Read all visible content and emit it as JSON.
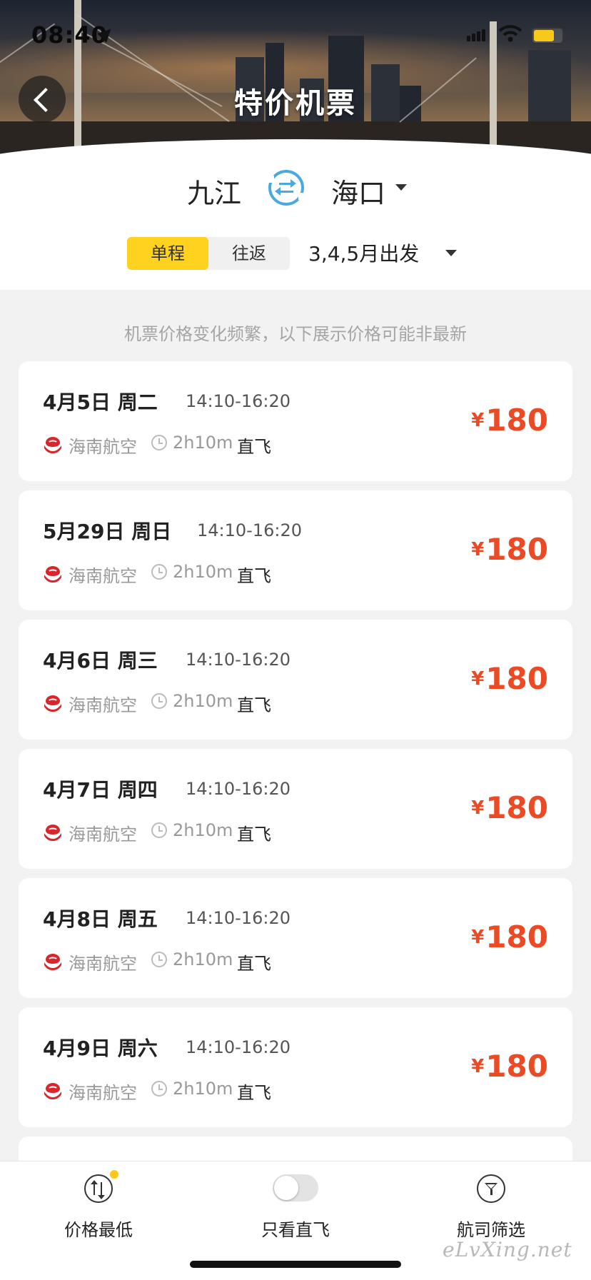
{
  "status_bar": {
    "time": "08:40"
  },
  "header": {
    "title": "特价机票"
  },
  "route": {
    "from_city": "九江",
    "to_city": "海口",
    "trip_types": [
      {
        "label": "单程",
        "selected": true
      },
      {
        "label": "往返",
        "selected": false
      }
    ],
    "departure": "3,4,5月出发"
  },
  "notice": "机票价格变化频繁，以下展示价格可能非最新",
  "flights": [
    {
      "date": "4月5日 周二",
      "time": "14:10-16:20",
      "airline": "海南航空",
      "duration": "2h10m",
      "type": "直飞",
      "currency": "¥",
      "price": "180"
    },
    {
      "date": "5月29日 周日",
      "time": "14:10-16:20",
      "airline": "海南航空",
      "duration": "2h10m",
      "type": "直飞",
      "currency": "¥",
      "price": "180"
    },
    {
      "date": "4月6日 周三",
      "time": "14:10-16:20",
      "airline": "海南航空",
      "duration": "2h10m",
      "type": "直飞",
      "currency": "¥",
      "price": "180"
    },
    {
      "date": "4月7日 周四",
      "time": "14:10-16:20",
      "airline": "海南航空",
      "duration": "2h10m",
      "type": "直飞",
      "currency": "¥",
      "price": "180"
    },
    {
      "date": "4月8日 周五",
      "time": "14:10-16:20",
      "airline": "海南航空",
      "duration": "2h10m",
      "type": "直飞",
      "currency": "¥",
      "price": "180"
    },
    {
      "date": "4月9日 周六",
      "time": "14:10-16:20",
      "airline": "海南航空",
      "duration": "2h10m",
      "type": "直飞",
      "currency": "¥",
      "price": "180"
    }
  ],
  "tabbar": {
    "price_sort": "价格最低",
    "direct_only": "只看直飞",
    "direct_only_enabled": false,
    "airline_filter": "航司筛选"
  },
  "watermark": "eLvXing.net",
  "colors": {
    "accent_yellow": "#ffd21f",
    "price_red": "#ec4a24",
    "swap_blue": "#4aa9e0"
  }
}
